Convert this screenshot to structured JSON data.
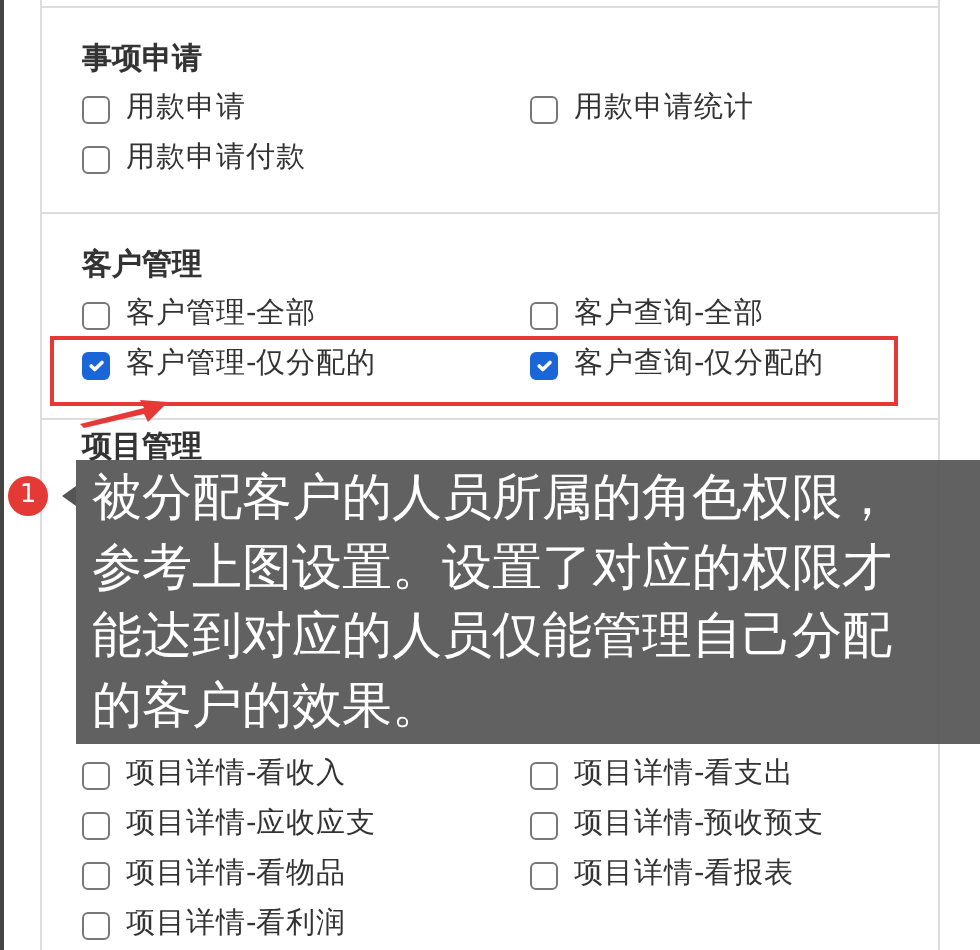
{
  "sections": [
    {
      "title": "事项申请",
      "rows": [
        {
          "highlighted": false,
          "items": [
            {
              "label": "用款申请",
              "checked": false
            },
            {
              "label": "用款申请统计",
              "checked": false
            }
          ]
        },
        {
          "highlighted": false,
          "items": [
            {
              "label": "用款申请付款",
              "checked": false
            }
          ]
        }
      ]
    },
    {
      "title": "客户管理",
      "rows": [
        {
          "highlighted": false,
          "items": [
            {
              "label": "客户管理-全部",
              "checked": false
            },
            {
              "label": "客户查询-全部",
              "checked": false
            }
          ]
        },
        {
          "highlighted": true,
          "items": [
            {
              "label": "客户管理-仅分配的",
              "checked": true
            },
            {
              "label": "客户查询-仅分配的",
              "checked": true
            }
          ]
        }
      ]
    },
    {
      "title": "项目管理",
      "rows": [
        {
          "highlighted": false,
          "items": [
            {
              "label": "项目详情-看收入",
              "checked": false
            },
            {
              "label": "项目详情-看支出",
              "checked": false
            }
          ]
        },
        {
          "highlighted": false,
          "items": [
            {
              "label": "项目详情-应收应支",
              "checked": false
            },
            {
              "label": "项目详情-预收预支",
              "checked": false
            }
          ]
        },
        {
          "highlighted": false,
          "items": [
            {
              "label": "项目详情-看物品",
              "checked": false
            },
            {
              "label": "项目详情-看报表",
              "checked": false
            }
          ]
        },
        {
          "highlighted": false,
          "items": [
            {
              "label": "项目详情-看利润",
              "checked": false
            }
          ]
        }
      ]
    }
  ],
  "callout": {
    "number": "1",
    "text": "被分配客户的人员所属的角色权限，参考上图设置。设置了对应的权限才能达到对应的人员仅能管理自己分配的客户的效果。"
  }
}
